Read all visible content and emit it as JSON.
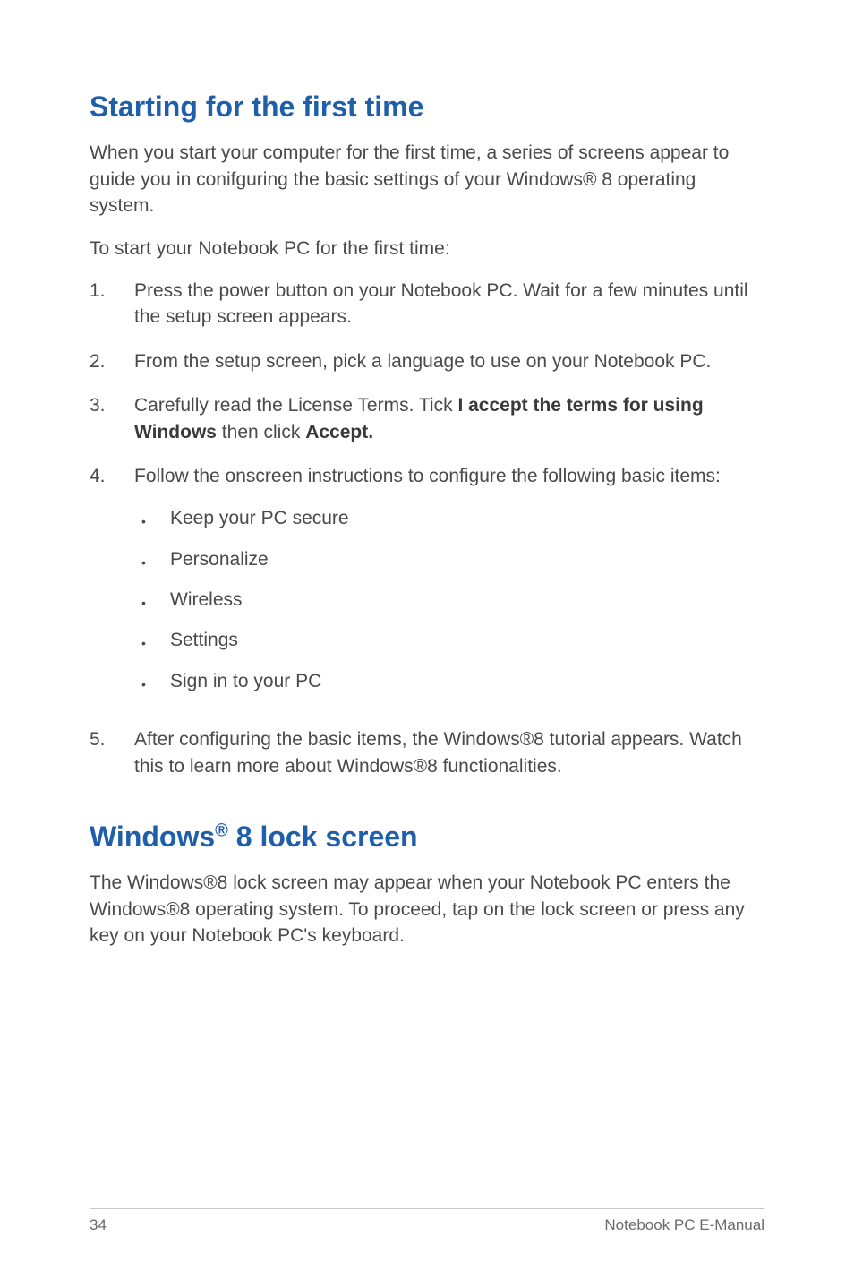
{
  "h1": "Starting for the first time",
  "p1": "When you start your computer for the first time, a series of screens appear to guide you in conifguring the basic settings of your Windows® 8 operating system.",
  "p2": "To start your Notebook PC for the first time:",
  "steps": {
    "n1": "1.",
    "t1": "Press the power button on your Notebook PC. Wait for a few minutes until the setup screen appears.",
    "n2": "2.",
    "t2": "From the setup screen, pick a language to use on your Notebook PC.",
    "n3": "3.",
    "t3a": "Carefully read the License Terms. Tick ",
    "t3b": "I accept the terms for using Windows",
    "t3c": " then click ",
    "t3d": "Accept.",
    "n4": "4.",
    "t4": "Follow the onscreen instructions to configure the following basic items:",
    "b1": "Keep your PC secure",
    "b2": "Personalize",
    "b3": "Wireless",
    "b4": "Settings",
    "b5": "Sign in to your PC",
    "n5": "5.",
    "t5": "After configuring the basic items, the Windows®8 tutorial appears. Watch this to learn more about Windows®8 functionalities."
  },
  "h2a": "Windows",
  "h2b": "®",
  "h2c": " 8 lock screen",
  "p3": "The Windows®8 lock screen may appear when your Notebook PC enters the Windows®8 operating system. To proceed,  tap on the lock screen or press any key on your Notebook PC's keyboard.",
  "footer": {
    "page": "34",
    "title": "Notebook PC E-Manual"
  }
}
